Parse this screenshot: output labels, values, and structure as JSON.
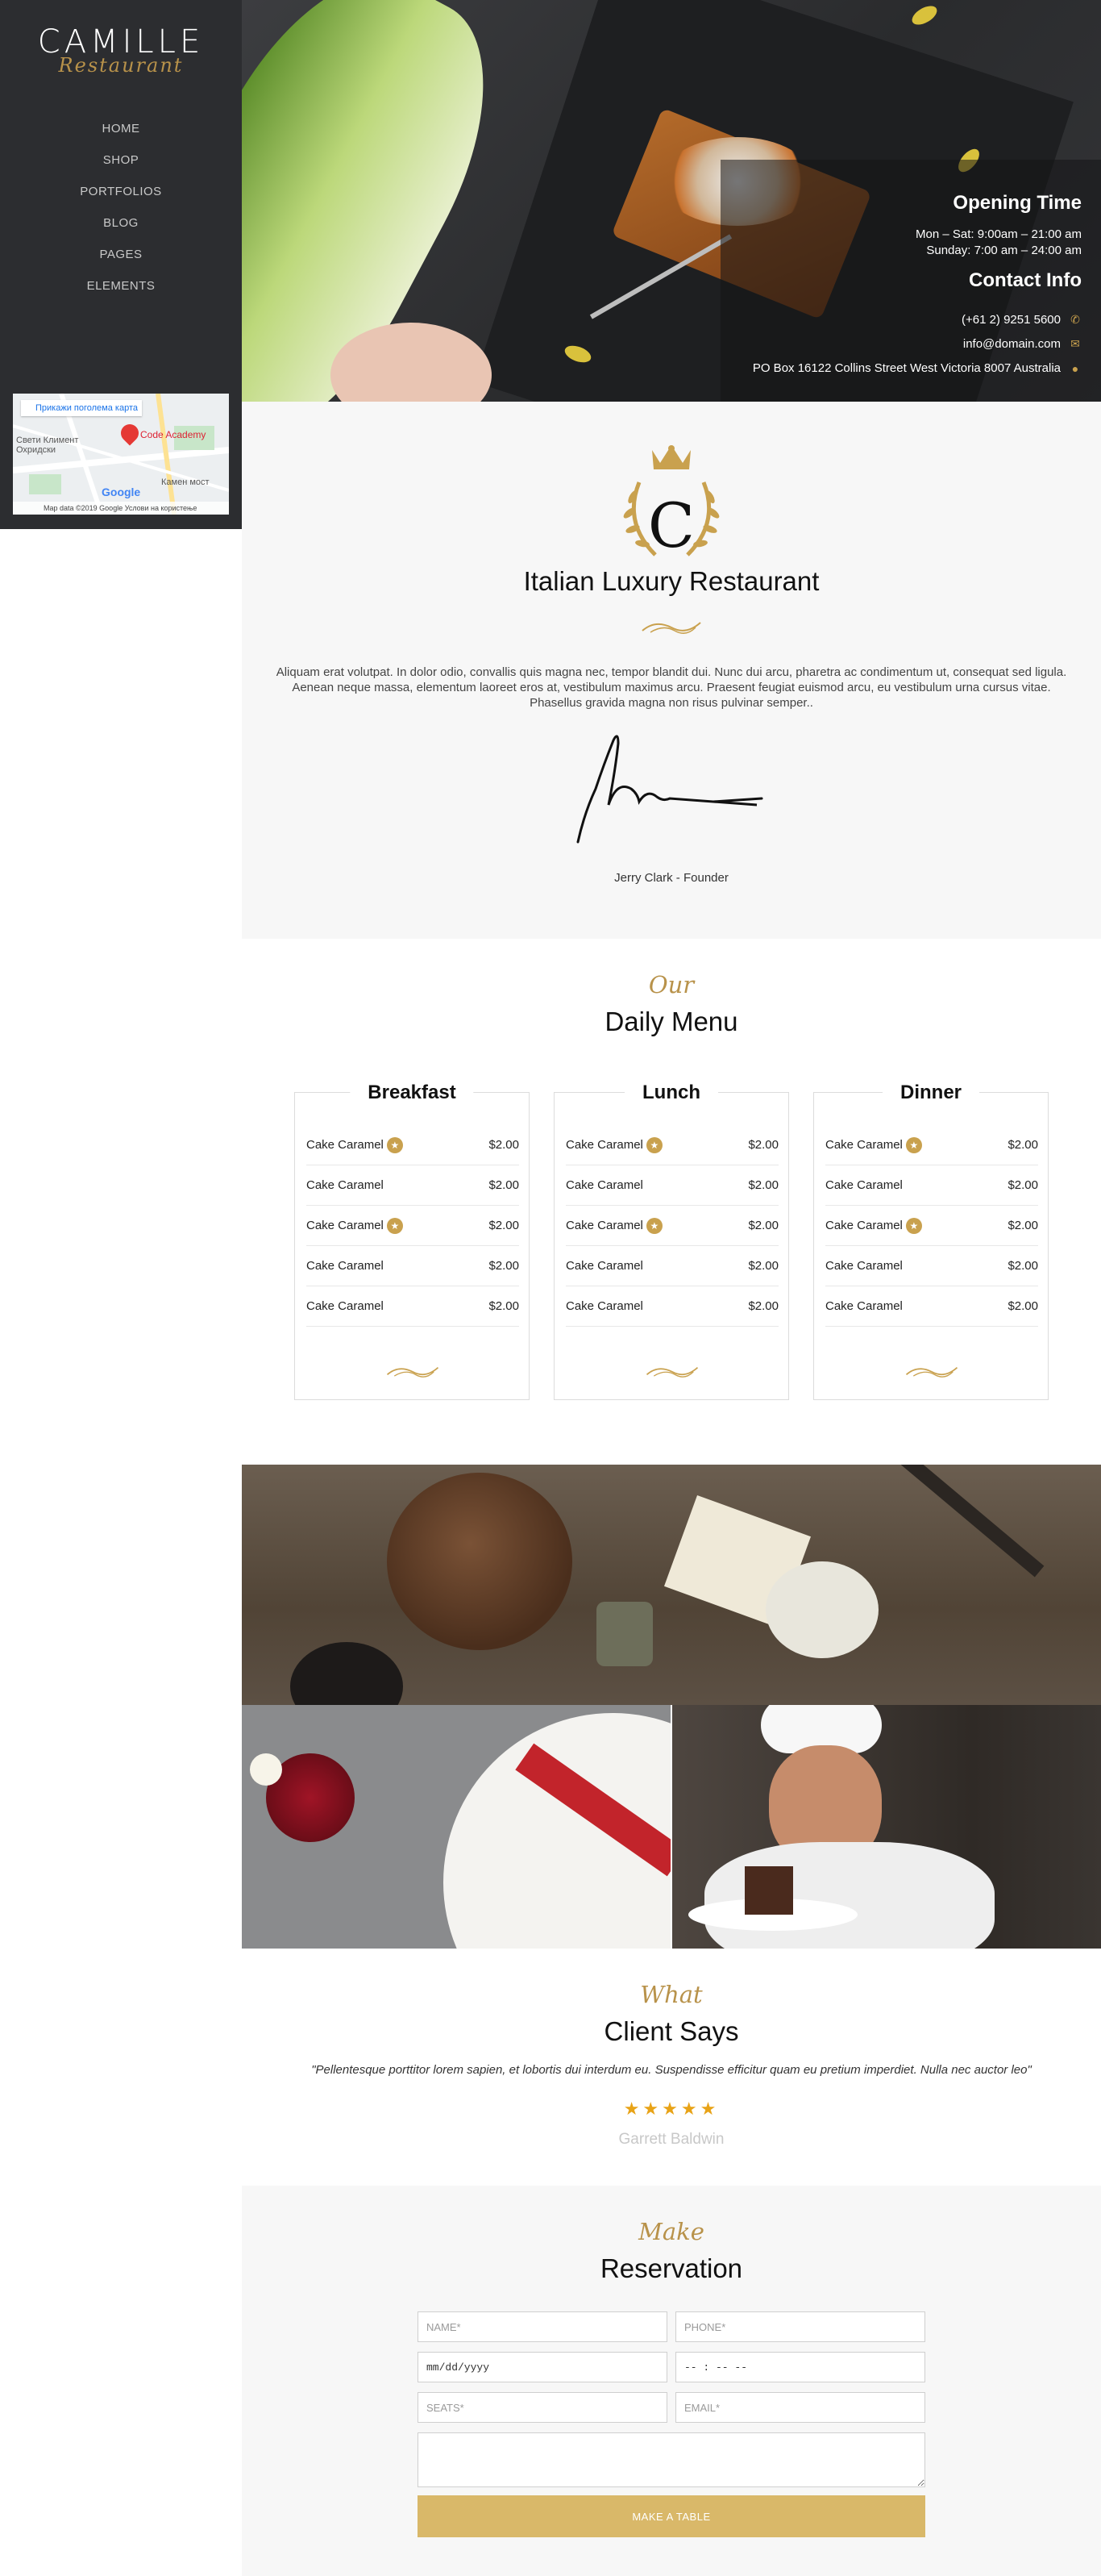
{
  "sidebar": {
    "logo_main": "CAMILLE",
    "logo_sub": "Restaurant",
    "nav": [
      "HOME",
      "SHOP",
      "PORTFOLIOS",
      "BLOG",
      "PAGES",
      "ELEMENTS"
    ],
    "map": {
      "button": "Прикажи поголема карта",
      "labels": [
        "Свети Климент Охридски",
        "Камен мост"
      ],
      "pin_label": "Code Academy",
      "google": "Google",
      "footer": "Map data ©2019 Google    Услови на користење"
    }
  },
  "hero": {
    "opening_title": "Opening Time",
    "opening_lines": [
      "Mon – Sat: 9:00am – 21:00 am",
      "Sunday: 7:00 am – 24:00 am"
    ],
    "contact_title": "Contact Info",
    "contact": {
      "phone": "(+61 2) 9251 5600",
      "email": "info@domain.com",
      "address": "PO Box 16122 Collins Street West Victoria 8007 Australia"
    },
    "icons": {
      "phone": "phone-icon",
      "email": "envelope-icon",
      "address": "map-marker-icon"
    }
  },
  "about": {
    "crest_letter": "C",
    "title": "Italian Luxury Restaurant",
    "text": "Aliquam erat volutpat. In dolor odio, convallis quis magna nec, tempor blandit dui. Nunc dui arcu, pharetra ac condimentum ut, consequat sed ligula. Aenean neque massa, elementum laoreet eros at, vestibulum maximus arcu. Praesent feugiat euismod arcu, eu vestibulum urna cursus vitae. Phasellus gravida magna non risus pulvinar semper..",
    "founder": "Jerry Clark - Founder"
  },
  "menu": {
    "subtitle": "Our",
    "title": "Daily Menu",
    "cards": [
      {
        "title": "Breakfast",
        "items": [
          {
            "name": "Cake Caramel",
            "price": "$2.00",
            "star": true
          },
          {
            "name": "Cake Caramel",
            "price": "$2.00",
            "star": false
          },
          {
            "name": "Cake Caramel",
            "price": "$2.00",
            "star": true
          },
          {
            "name": "Cake Caramel",
            "price": "$2.00",
            "star": false
          },
          {
            "name": "Cake Caramel",
            "price": "$2.00",
            "star": false
          }
        ]
      },
      {
        "title": "Lunch",
        "items": [
          {
            "name": "Cake Caramel",
            "price": "$2.00",
            "star": true
          },
          {
            "name": "Cake Caramel",
            "price": "$2.00",
            "star": false
          },
          {
            "name": "Cake Caramel",
            "price": "$2.00",
            "star": true
          },
          {
            "name": "Cake Caramel",
            "price": "$2.00",
            "star": false
          },
          {
            "name": "Cake Caramel",
            "price": "$2.00",
            "star": false
          }
        ]
      },
      {
        "title": "Dinner",
        "items": [
          {
            "name": "Cake Caramel",
            "price": "$2.00",
            "star": true
          },
          {
            "name": "Cake Caramel",
            "price": "$2.00",
            "star": false
          },
          {
            "name": "Cake Caramel",
            "price": "$2.00",
            "star": true
          },
          {
            "name": "Cake Caramel",
            "price": "$2.00",
            "star": false
          },
          {
            "name": "Cake Caramel",
            "price": "$2.00",
            "star": false
          }
        ]
      }
    ]
  },
  "testimonial": {
    "subtitle": "What",
    "title": "Client Says",
    "quote": "\"Pellentesque porttitor lorem sapien, et lobortis dui interdum eu. Suspendisse efficitur quam eu pretium imperdiet. Nulla nec auctor leo\"",
    "stars": "★★★★★",
    "rating": 5,
    "client": "Garrett Baldwin"
  },
  "reservation": {
    "subtitle": "Make",
    "title": "Reservation",
    "name_placeholder": "NAME*",
    "phone_placeholder": "PHONE*",
    "date_value": "mm/dd/yyyy",
    "time_value": "-- : -- --",
    "seats_placeholder": "SEATS*",
    "email_placeholder": "EMAIL*",
    "button": "MAKE A TABLE"
  },
  "colors": {
    "gold": "#b8924a",
    "button": "#d9b869",
    "star": "#e8a317",
    "sidebar_bg": "#2c2d30"
  }
}
